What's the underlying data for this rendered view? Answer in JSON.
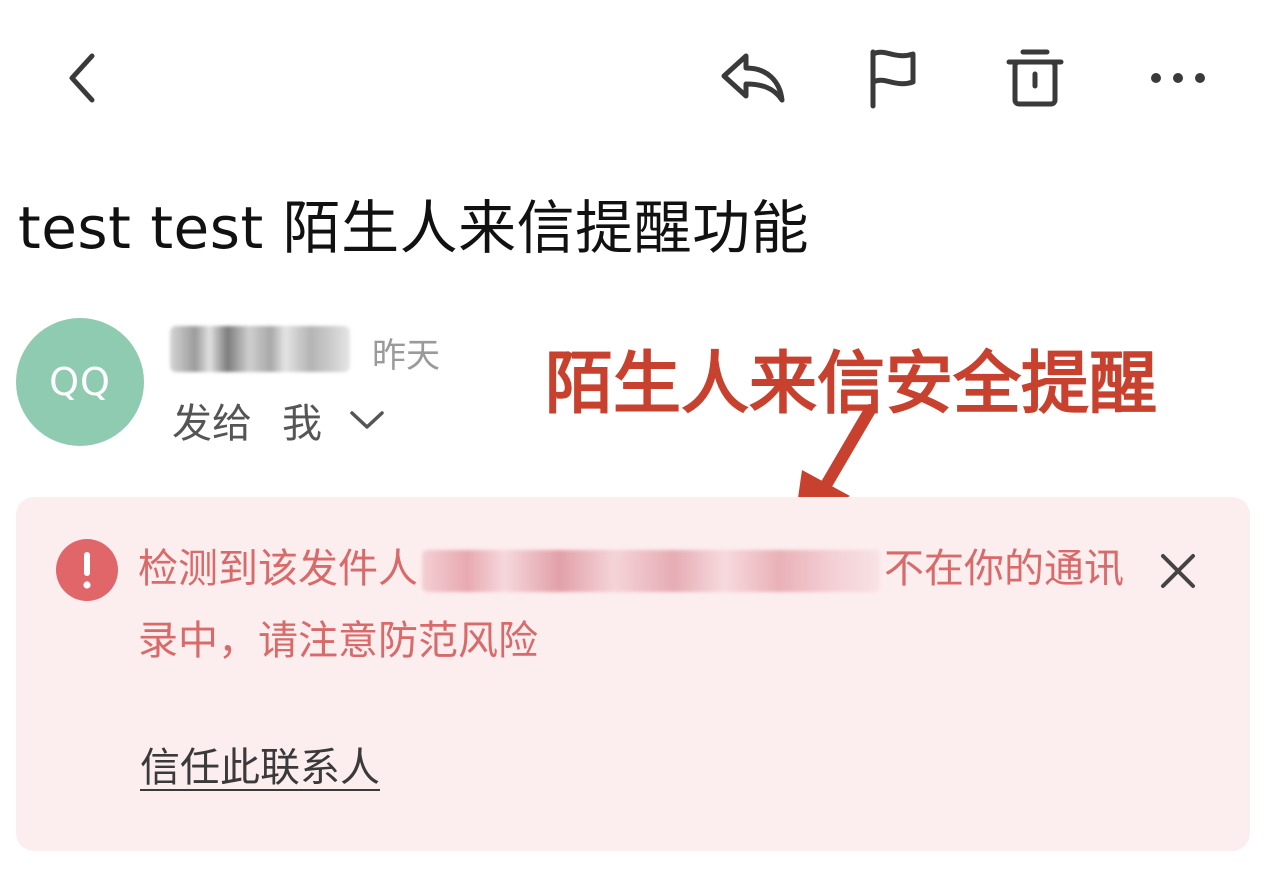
{
  "toolbar": {
    "icons": [
      "chevron-left-icon",
      "reply-icon",
      "flag-icon",
      "trash-icon",
      "more-icon"
    ]
  },
  "email": {
    "subject": "test test 陌生人来信提醒功能",
    "avatar_text": "QQ",
    "time": "昨天",
    "to_prefix": "发给",
    "to_name": "我"
  },
  "annotation": {
    "text": "陌生人来信安全提醒"
  },
  "warning": {
    "text_before": "检测到该发件人",
    "text_after": "不在你的通讯录中，请注意防范风险",
    "trust_link": "信任此联系人"
  },
  "colors": {
    "avatar_bg": "#8fcbb0",
    "annotation": "#c8412f",
    "alert_bg": "#fcedee",
    "alert_text": "#d96a6a",
    "alert_icon": "#e0666a"
  }
}
